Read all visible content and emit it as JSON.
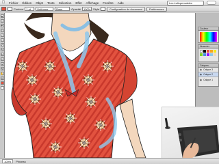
{
  "menubar": {
    "items": [
      "Fichier",
      "Édition",
      "Objet",
      "Texte",
      "Sélection",
      "Effet",
      "Affichage",
      "Fenêtre",
      "Aide"
    ],
    "workspace": "Les indispensables"
  },
  "control_bar": {
    "selection_label": "Contour",
    "stroke_value": "1 pt",
    "style_label": "Uniforme",
    "basic_label": "Base",
    "opacity_label": "Opacité",
    "opacity_value": "100%",
    "style2_label": "Style",
    "document_setup": "Configuration du document",
    "preferences": "Préférences"
  },
  "panels": {
    "color_title": "Couleur",
    "swatches_title": "Nuancier",
    "layers_title": "Calques",
    "layers": [
      "Calque 3",
      "Calque 2",
      "Calque 1"
    ]
  },
  "statusbar": {
    "zoom": "100%",
    "info": "Pinceau"
  },
  "colors": {
    "shirt": "#e2523f",
    "shirt_stripe": "#c8382c",
    "blue_stroke": "#8ec8ec",
    "skin": "#f3d7bd",
    "hair": "#3a2a1e",
    "bow": "#c42a2a"
  }
}
